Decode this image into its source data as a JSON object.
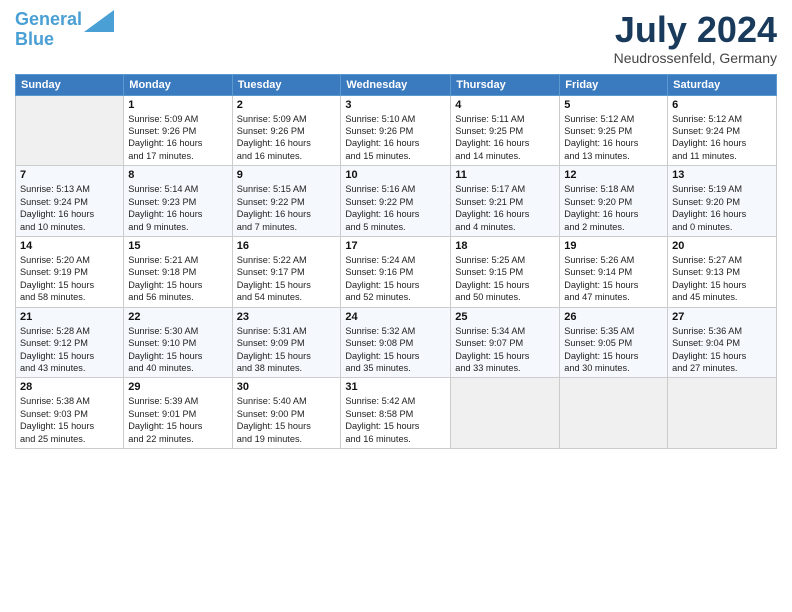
{
  "logo": {
    "line1": "General",
    "line2": "Blue"
  },
  "title": "July 2024",
  "location": "Neudrossenfeld, Germany",
  "days_header": [
    "Sunday",
    "Monday",
    "Tuesday",
    "Wednesday",
    "Thursday",
    "Friday",
    "Saturday"
  ],
  "weeks": [
    [
      {
        "day": "",
        "info": ""
      },
      {
        "day": "1",
        "info": "Sunrise: 5:09 AM\nSunset: 9:26 PM\nDaylight: 16 hours\nand 17 minutes."
      },
      {
        "day": "2",
        "info": "Sunrise: 5:09 AM\nSunset: 9:26 PM\nDaylight: 16 hours\nand 16 minutes."
      },
      {
        "day": "3",
        "info": "Sunrise: 5:10 AM\nSunset: 9:26 PM\nDaylight: 16 hours\nand 15 minutes."
      },
      {
        "day": "4",
        "info": "Sunrise: 5:11 AM\nSunset: 9:25 PM\nDaylight: 16 hours\nand 14 minutes."
      },
      {
        "day": "5",
        "info": "Sunrise: 5:12 AM\nSunset: 9:25 PM\nDaylight: 16 hours\nand 13 minutes."
      },
      {
        "day": "6",
        "info": "Sunrise: 5:12 AM\nSunset: 9:24 PM\nDaylight: 16 hours\nand 11 minutes."
      }
    ],
    [
      {
        "day": "7",
        "info": "Sunrise: 5:13 AM\nSunset: 9:24 PM\nDaylight: 16 hours\nand 10 minutes."
      },
      {
        "day": "8",
        "info": "Sunrise: 5:14 AM\nSunset: 9:23 PM\nDaylight: 16 hours\nand 9 minutes."
      },
      {
        "day": "9",
        "info": "Sunrise: 5:15 AM\nSunset: 9:22 PM\nDaylight: 16 hours\nand 7 minutes."
      },
      {
        "day": "10",
        "info": "Sunrise: 5:16 AM\nSunset: 9:22 PM\nDaylight: 16 hours\nand 5 minutes."
      },
      {
        "day": "11",
        "info": "Sunrise: 5:17 AM\nSunset: 9:21 PM\nDaylight: 16 hours\nand 4 minutes."
      },
      {
        "day": "12",
        "info": "Sunrise: 5:18 AM\nSunset: 9:20 PM\nDaylight: 16 hours\nand 2 minutes."
      },
      {
        "day": "13",
        "info": "Sunrise: 5:19 AM\nSunset: 9:20 PM\nDaylight: 16 hours\nand 0 minutes."
      }
    ],
    [
      {
        "day": "14",
        "info": "Sunrise: 5:20 AM\nSunset: 9:19 PM\nDaylight: 15 hours\nand 58 minutes."
      },
      {
        "day": "15",
        "info": "Sunrise: 5:21 AM\nSunset: 9:18 PM\nDaylight: 15 hours\nand 56 minutes."
      },
      {
        "day": "16",
        "info": "Sunrise: 5:22 AM\nSunset: 9:17 PM\nDaylight: 15 hours\nand 54 minutes."
      },
      {
        "day": "17",
        "info": "Sunrise: 5:24 AM\nSunset: 9:16 PM\nDaylight: 15 hours\nand 52 minutes."
      },
      {
        "day": "18",
        "info": "Sunrise: 5:25 AM\nSunset: 9:15 PM\nDaylight: 15 hours\nand 50 minutes."
      },
      {
        "day": "19",
        "info": "Sunrise: 5:26 AM\nSunset: 9:14 PM\nDaylight: 15 hours\nand 47 minutes."
      },
      {
        "day": "20",
        "info": "Sunrise: 5:27 AM\nSunset: 9:13 PM\nDaylight: 15 hours\nand 45 minutes."
      }
    ],
    [
      {
        "day": "21",
        "info": "Sunrise: 5:28 AM\nSunset: 9:12 PM\nDaylight: 15 hours\nand 43 minutes."
      },
      {
        "day": "22",
        "info": "Sunrise: 5:30 AM\nSunset: 9:10 PM\nDaylight: 15 hours\nand 40 minutes."
      },
      {
        "day": "23",
        "info": "Sunrise: 5:31 AM\nSunset: 9:09 PM\nDaylight: 15 hours\nand 38 minutes."
      },
      {
        "day": "24",
        "info": "Sunrise: 5:32 AM\nSunset: 9:08 PM\nDaylight: 15 hours\nand 35 minutes."
      },
      {
        "day": "25",
        "info": "Sunrise: 5:34 AM\nSunset: 9:07 PM\nDaylight: 15 hours\nand 33 minutes."
      },
      {
        "day": "26",
        "info": "Sunrise: 5:35 AM\nSunset: 9:05 PM\nDaylight: 15 hours\nand 30 minutes."
      },
      {
        "day": "27",
        "info": "Sunrise: 5:36 AM\nSunset: 9:04 PM\nDaylight: 15 hours\nand 27 minutes."
      }
    ],
    [
      {
        "day": "28",
        "info": "Sunrise: 5:38 AM\nSunset: 9:03 PM\nDaylight: 15 hours\nand 25 minutes."
      },
      {
        "day": "29",
        "info": "Sunrise: 5:39 AM\nSunset: 9:01 PM\nDaylight: 15 hours\nand 22 minutes."
      },
      {
        "day": "30",
        "info": "Sunrise: 5:40 AM\nSunset: 9:00 PM\nDaylight: 15 hours\nand 19 minutes."
      },
      {
        "day": "31",
        "info": "Sunrise: 5:42 AM\nSunset: 8:58 PM\nDaylight: 15 hours\nand 16 minutes."
      },
      {
        "day": "",
        "info": ""
      },
      {
        "day": "",
        "info": ""
      },
      {
        "day": "",
        "info": ""
      }
    ]
  ]
}
